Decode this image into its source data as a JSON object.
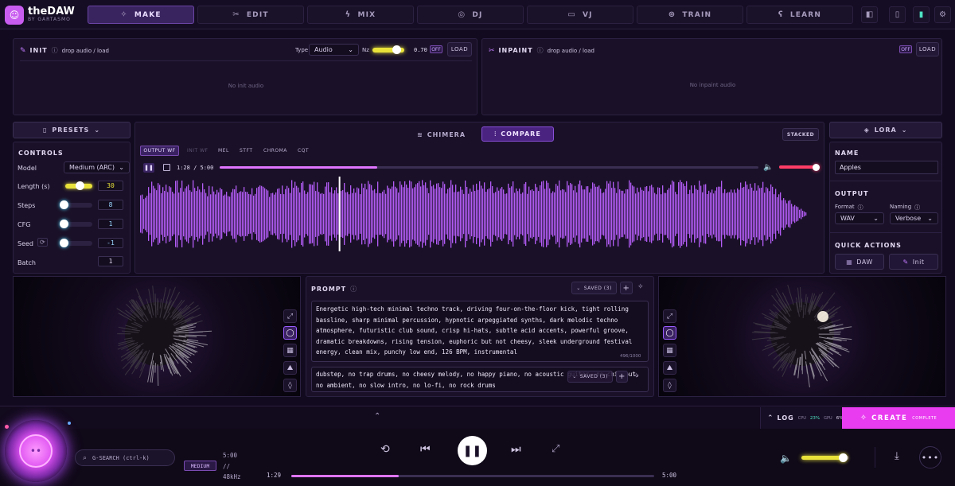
{
  "app": {
    "logo_glyph": "☺",
    "title": "theDAW",
    "subtitle": "BY GARTASMO"
  },
  "tabs": [
    {
      "label": "MAKE",
      "icon": "sparkles-icon",
      "glyph": "✧",
      "active": true
    },
    {
      "label": "EDIT",
      "icon": "scissors-icon",
      "glyph": "✂"
    },
    {
      "label": "MIX",
      "icon": "bolt-icon",
      "glyph": "ϟ"
    },
    {
      "label": "DJ",
      "icon": "disc-icon",
      "glyph": "◎"
    },
    {
      "label": "VJ",
      "icon": "monitor-icon",
      "glyph": "▭"
    },
    {
      "label": "TRAIN",
      "icon": "brain-icon",
      "glyph": "⊛"
    },
    {
      "label": "LEARN",
      "icon": "ear-icon",
      "glyph": "ʕ"
    }
  ],
  "init": {
    "label": "INIT",
    "hint": "drop audio / load",
    "type_label": "Type",
    "type_value": "Audio",
    "nz_label": "Nz",
    "nz_value": "0.70",
    "off": "OFF",
    "load": "LOAD",
    "empty": "No init audio"
  },
  "inpaint": {
    "label": "INPAINT",
    "hint": "drop audio / load",
    "off": "OFF",
    "load": "LOAD",
    "empty": "No inpaint audio"
  },
  "presets": {
    "label": "PRESETS"
  },
  "lora": {
    "label": "LORA"
  },
  "controls": {
    "title": "CONTROLS",
    "model_label": "Model",
    "model_value": "Medium (ARC)",
    "length_label": "Length (s)",
    "length_value": "30",
    "steps_label": "Steps",
    "steps_value": "8",
    "cfg_label": "CFG",
    "cfg_value": "1",
    "seed_label": "Seed",
    "seed_value": "-1",
    "batch_label": "Batch",
    "batch_value": "1"
  },
  "viewer": {
    "chimera": "CHIMERA",
    "compare": "COMPARE",
    "stacked": "STACKED",
    "wf_tabs": [
      "OUTPUT WF",
      "INIT WF",
      "MEL",
      "STFT",
      "CHROMA",
      "CQT"
    ],
    "time": "1:28 / 5:00",
    "progress": 0.293,
    "volume": 0.9
  },
  "side": {
    "name_title": "NAME",
    "name_value": "Apples",
    "output_title": "OUTPUT",
    "format_label": "Format",
    "format_value": "WAV",
    "naming_label": "Naming",
    "naming_value": "Verbose",
    "qa_title": "QUICK ACTIONS",
    "qa_daw": "DAW",
    "qa_init": "Init"
  },
  "prompt": {
    "title": "PROMPT",
    "saved": "SAVED (3)",
    "saved2": "SAVED (3)",
    "text": "Energetic high-tech minimal techno track, driving four-on-the-floor kick, tight rolling bassline, sharp minimal percussion, hypnotic arpeggiated synths, dark melodic techno atmosphere, futuristic club sound, crisp hi-hats, subtle acid accents, powerful groove, dramatic breakdowns, rising tension, euphoric but not cheesy, sleek underground festival energy, clean mix, punchy low end, 126 BPM, instrumental",
    "count": "496/1000",
    "negative": "dubstep, no trap drums, no cheesy melody, no happy piano, no acoustic guitar, no chillout, no ambient, no slow intro, no lo-fi, no rock drums"
  },
  "footer": {
    "log": "LOG",
    "cpu_label": "CPU",
    "cpu_value": "23%",
    "gpu_label": "GPU",
    "gpu_value": "6%",
    "create": "CREATE",
    "create_status": "COMPLETE"
  },
  "player": {
    "search_placeholder": "G-SEARCH (ctrl-k)",
    "badge": "MEDIUM",
    "info_line1": "5:00",
    "info_line2": "//",
    "info_line3": "48kHz",
    "elapsed": "1:29",
    "total": "5:00",
    "progress": 0.297,
    "volume": 0.85
  },
  "colors": {
    "accent": "#b44dff",
    "wave": "#b35cf5",
    "create": "#e93bf0",
    "slider": "#e8e23a"
  }
}
